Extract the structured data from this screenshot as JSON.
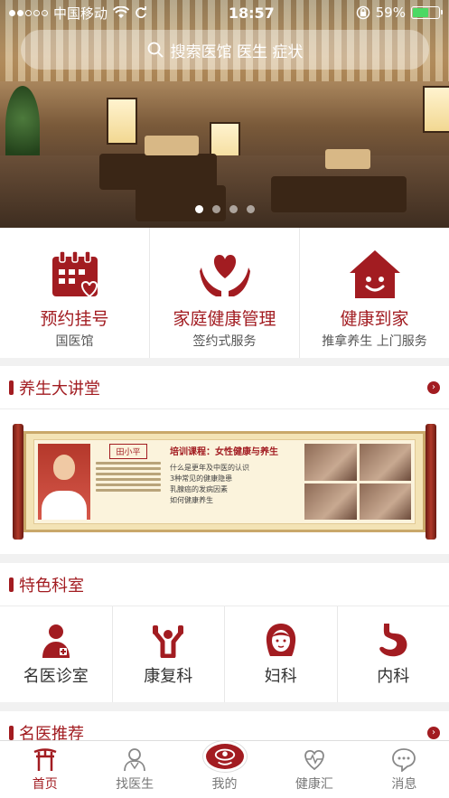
{
  "status_bar": {
    "carrier": "中国移动",
    "time": "18:57",
    "battery": "59%",
    "battery_level": 0.59
  },
  "search": {
    "placeholder": "搜索医馆 医生 症状"
  },
  "banner": {
    "slide_count": 4,
    "active_slide": 1
  },
  "services": [
    {
      "title": "预约挂号",
      "sub": "国医馆",
      "icon": "calendar-heart-icon"
    },
    {
      "title": "家庭健康管理",
      "sub": "签约式服务",
      "icon": "hands-heart-icon"
    },
    {
      "title": "健康到家",
      "sub": "推拿养生 上门服务",
      "icon": "house-smile-icon"
    }
  ],
  "lecture_section": {
    "title": "养生大讲堂",
    "doctor_name": "田小平",
    "course_title": "培训课程：女性健康与养生",
    "course_items": [
      "什么是更年及中医的认识",
      "3种常见的健康隐患",
      "乳腺癌的发病因素",
      "如何健康养生"
    ]
  },
  "dept_section": {
    "title": "特色科室",
    "items": [
      {
        "label": "名医诊室",
        "icon": "doctor-icon"
      },
      {
        "label": "康复科",
        "icon": "rehab-icon"
      },
      {
        "label": "妇科",
        "icon": "woman-icon"
      },
      {
        "label": "内科",
        "icon": "stomach-icon"
      }
    ]
  },
  "famous_section": {
    "title": "名医推荐"
  },
  "tabbar": {
    "items": [
      {
        "label": "首页",
        "icon": "home-gate-icon",
        "active": true
      },
      {
        "label": "找医生",
        "icon": "doctor-outline-icon",
        "active": false
      },
      {
        "label": "我的",
        "icon": "profile-icon",
        "active": false
      },
      {
        "label": "健康汇",
        "icon": "heart-pulse-icon",
        "active": false
      },
      {
        "label": "消息",
        "icon": "message-icon",
        "active": false
      }
    ]
  },
  "colors": {
    "brand": "#a21c21",
    "battery": "#4cd964"
  }
}
